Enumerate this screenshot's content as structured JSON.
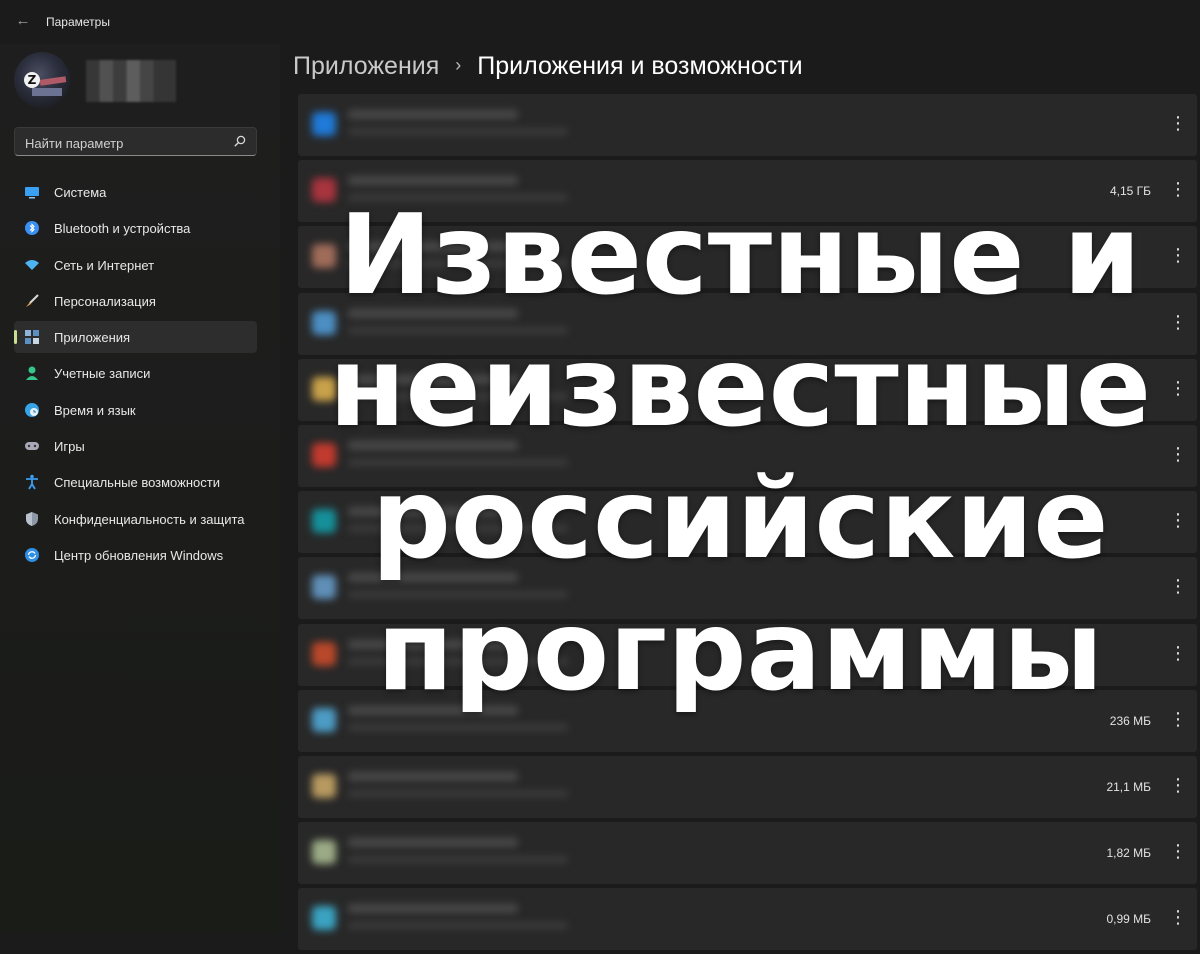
{
  "window": {
    "title": "Параметры"
  },
  "sidebar": {
    "search_placeholder": "Найти параметр",
    "items": [
      {
        "label": "Система",
        "icon": "monitor-icon",
        "color": "#3aa0f3"
      },
      {
        "label": "Bluetooth и устройства",
        "icon": "bluetooth-icon",
        "color": "#3a8ff5"
      },
      {
        "label": "Сеть и Интернет",
        "icon": "wifi-icon",
        "color": "#4cb4f0"
      },
      {
        "label": "Персонализация",
        "icon": "brush-icon",
        "color": "#e3a24f"
      },
      {
        "label": "Приложения",
        "icon": "apps-icon",
        "color": "#8fb3d9",
        "active": true
      },
      {
        "label": "Учетные записи",
        "icon": "user-icon",
        "color": "#35c48a"
      },
      {
        "label": "Время и язык",
        "icon": "globe-clock-icon",
        "color": "#38a4e8"
      },
      {
        "label": "Игры",
        "icon": "gamepad-icon",
        "color": "#a9a9b6"
      },
      {
        "label": "Специальные возможности",
        "icon": "accessibility-icon",
        "color": "#3a9df0"
      },
      {
        "label": "Конфиденциальность и защита",
        "icon": "shield-icon",
        "color": "#8d98a6"
      },
      {
        "label": "Центр обновления Windows",
        "icon": "update-icon",
        "color": "#2e8fe6"
      }
    ]
  },
  "breadcrumb": {
    "parent": "Приложения",
    "current": "Приложения и возможности"
  },
  "apps": [
    {
      "size": "",
      "icon_color": "#1f7ad8"
    },
    {
      "size": "4,15 ГБ",
      "icon_color": "#a8343e"
    },
    {
      "size": "",
      "icon_color": "#a06c5a"
    },
    {
      "size": "",
      "icon_color": "#4c8fc4"
    },
    {
      "size": "",
      "icon_color": "#c9a24a"
    },
    {
      "size": "",
      "icon_color": "#c23a2e"
    },
    {
      "size": "",
      "icon_color": "#15909a"
    },
    {
      "size": "",
      "icon_color": "#5f8fb8"
    },
    {
      "size": "",
      "icon_color": "#b9482a"
    },
    {
      "size": "236 МБ",
      "icon_color": "#4d9cc5"
    },
    {
      "size": "21,1 МБ",
      "icon_color": "#b89a60"
    },
    {
      "size": "1,82 МБ",
      "icon_color": "#9cab86"
    },
    {
      "size": "0,99 МБ",
      "icon_color": "#3aa3c2"
    }
  ],
  "more_glyph": "⋮",
  "overlay": {
    "lines": [
      "Известные и",
      "неизвестные",
      "российские",
      "программы"
    ]
  }
}
